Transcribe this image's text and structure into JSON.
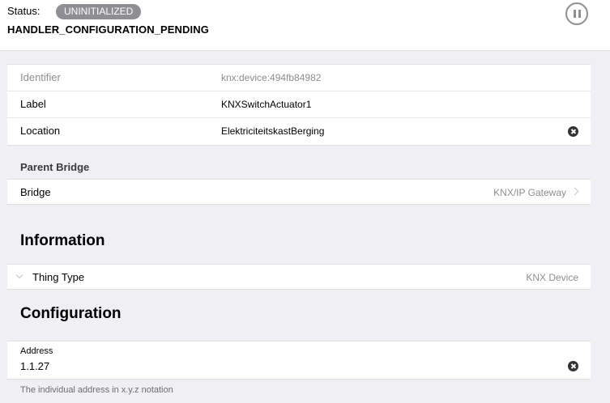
{
  "status": {
    "label": "Status:",
    "badge": "UNINITIALIZED",
    "detail": "HANDLER_CONFIGURATION_PENDING"
  },
  "thing": {
    "identifier": {
      "label": "Identifier",
      "value": "knx:device:494fb84982"
    },
    "label_field": {
      "label": "Label",
      "value": "KNXSwitchActuator1"
    },
    "location": {
      "label": "Location",
      "value": "ElektriciteitskastBerging"
    }
  },
  "parent_bridge": {
    "title": "Parent Bridge",
    "label": "Bridge",
    "value": "KNX/IP Gateway"
  },
  "information": {
    "title": "Information",
    "thing_type_label": "Thing Type",
    "thing_type_value": "KNX Device"
  },
  "configuration": {
    "title": "Configuration",
    "address_label": "Address",
    "address_value": "1.1.27",
    "address_hint": "The individual address in x.y.z notation"
  },
  "icons": [
    "pause-icon",
    "clear-icon",
    "chevron-right-icon",
    "chevron-down-icon"
  ]
}
